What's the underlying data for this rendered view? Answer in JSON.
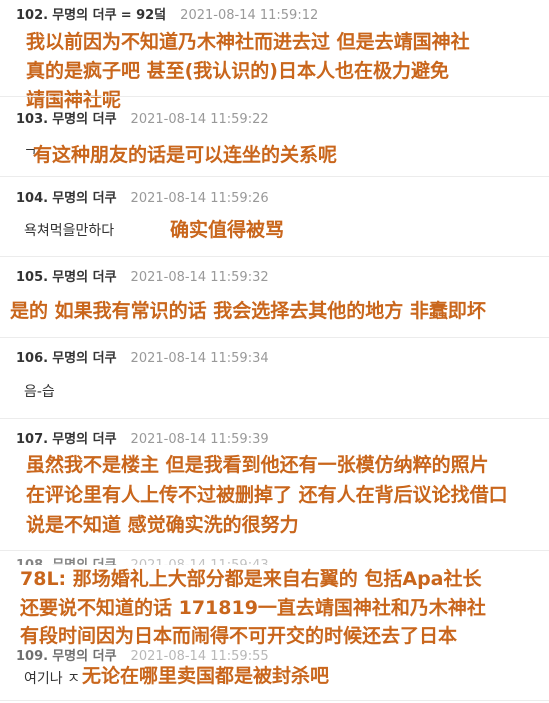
{
  "posts": [
    {
      "number": "102.",
      "author": "무명의 더쿠",
      "extra": "= 92덬",
      "time": "2021-08-14 11:59:12",
      "body": "",
      "translation": [
        "我以前因为不知道乃木神社而进去过 但是去靖国神社",
        "真的是疯子吧 甚至(我认识的)日本人也在极力避免",
        "靖国神社呢"
      ]
    },
    {
      "number": "103.",
      "author": "무명의 더쿠",
      "time": "2021-08-14 11:59:22",
      "body": "ᄀ",
      "translation": [
        "有这种朋友的话是可以连坐的关系呢"
      ]
    },
    {
      "number": "104.",
      "author": "무명의 더쿠",
      "time": "2021-08-14 11:59:26",
      "body": "욕쳐먹을만하다",
      "translation": [
        "确实值得被骂"
      ]
    },
    {
      "number": "105.",
      "author": "무명의 더쿠",
      "time": "2021-08-14 11:59:32",
      "body": "",
      "translation": [
        "是的 如果我有常识的话 我会选择去其他的地方 非蠢即坏"
      ]
    },
    {
      "number": "106.",
      "author": "무명의 더쿠",
      "time": "2021-08-14 11:59:34",
      "body": "음-습",
      "translation": []
    },
    {
      "number": "107.",
      "author": "무명의 더쿠",
      "time": "2021-08-14 11:59:39",
      "body": "",
      "translation": [
        "虽然我不是楼主 但是我看到他还有一张模仿纳粹的照片",
        "在评论里有人上传不过被删掉了 还有人在背后议论找借口",
        "说是不知道 感觉确实洗的很努力"
      ]
    },
    {
      "number": "108.",
      "author": "무명의 더쿠",
      "time": "2021-08-14 11:59:43",
      "body": "",
      "translation": [
        "78L: 那场婚礼上大部分都是来自右翼的 包括Apa社长",
        "还要说不知道的话 171819一直去靖国神社和乃木神社",
        "有段时间因为日本而闹得不可开交的时候还去了日本"
      ]
    },
    {
      "number": "109.",
      "author": "무명의 더쿠",
      "time": "2021-08-14 11:59:55",
      "body": "여기나 ㅈ",
      "translation": [
        "无论在哪里卖国都是被封杀吧"
      ]
    }
  ]
}
